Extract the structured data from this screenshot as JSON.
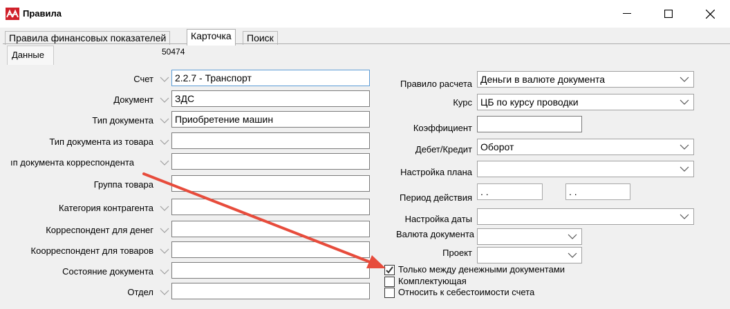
{
  "window": {
    "title": "Правила",
    "icon": "app-logo-icon"
  },
  "tabs": [
    {
      "label": "Правила финансовых показателей"
    },
    {
      "label": "Карточка"
    },
    {
      "label": "Поиск"
    }
  ],
  "subtab": {
    "label": "Данные"
  },
  "code": "50474",
  "left_fields": [
    {
      "label": "Счет",
      "value": "    2.2.7 - Транспорт"
    },
    {
      "label": "Документ",
      "value": "ЗДС"
    },
    {
      "label": "Тип документа",
      "value": "Приобретение машин"
    },
    {
      "label": "Тип документа из товара",
      "value": ""
    },
    {
      "label": "ıп документа корреспондента",
      "value": ""
    },
    {
      "label": "Группа товара",
      "value": ""
    },
    {
      "label": "Категория контрагента",
      "value": ""
    },
    {
      "label": "Корреспондент для денег",
      "value": ""
    },
    {
      "label": "Коорреспондент для товаров",
      "value": ""
    },
    {
      "label": "Состояние документа",
      "value": ""
    },
    {
      "label": "Отдел",
      "value": ""
    }
  ],
  "right_fields": {
    "rule": {
      "label": "Правило расчета",
      "value": "Деньги в валюте документа"
    },
    "rate": {
      "label": "Курс",
      "value": "ЦБ по курсу проводки"
    },
    "coef": {
      "label": "Коэффициент",
      "value": ""
    },
    "debit": {
      "label": "Дебет/Кредит",
      "value": "Оборот"
    },
    "plan": {
      "label": "Настройка плана",
      "value": ""
    },
    "period": {
      "label": "Период действия",
      "from": " .  .",
      "to": " .  ."
    },
    "date_setting": {
      "label": "Настройка даты",
      "value": ""
    },
    "currency": {
      "label": "Валюта документа",
      "value": ""
    },
    "project": {
      "label": "Проект",
      "value": ""
    }
  },
  "checkboxes": [
    {
      "label": "Только между денежными документами",
      "checked": true
    },
    {
      "label": "Комплектующая",
      "checked": false
    },
    {
      "label": "Относить к себестоимости счета",
      "checked": false
    }
  ],
  "colors": {
    "arrow": "#e74c3c",
    "focus_border": "#5b9bd5"
  }
}
